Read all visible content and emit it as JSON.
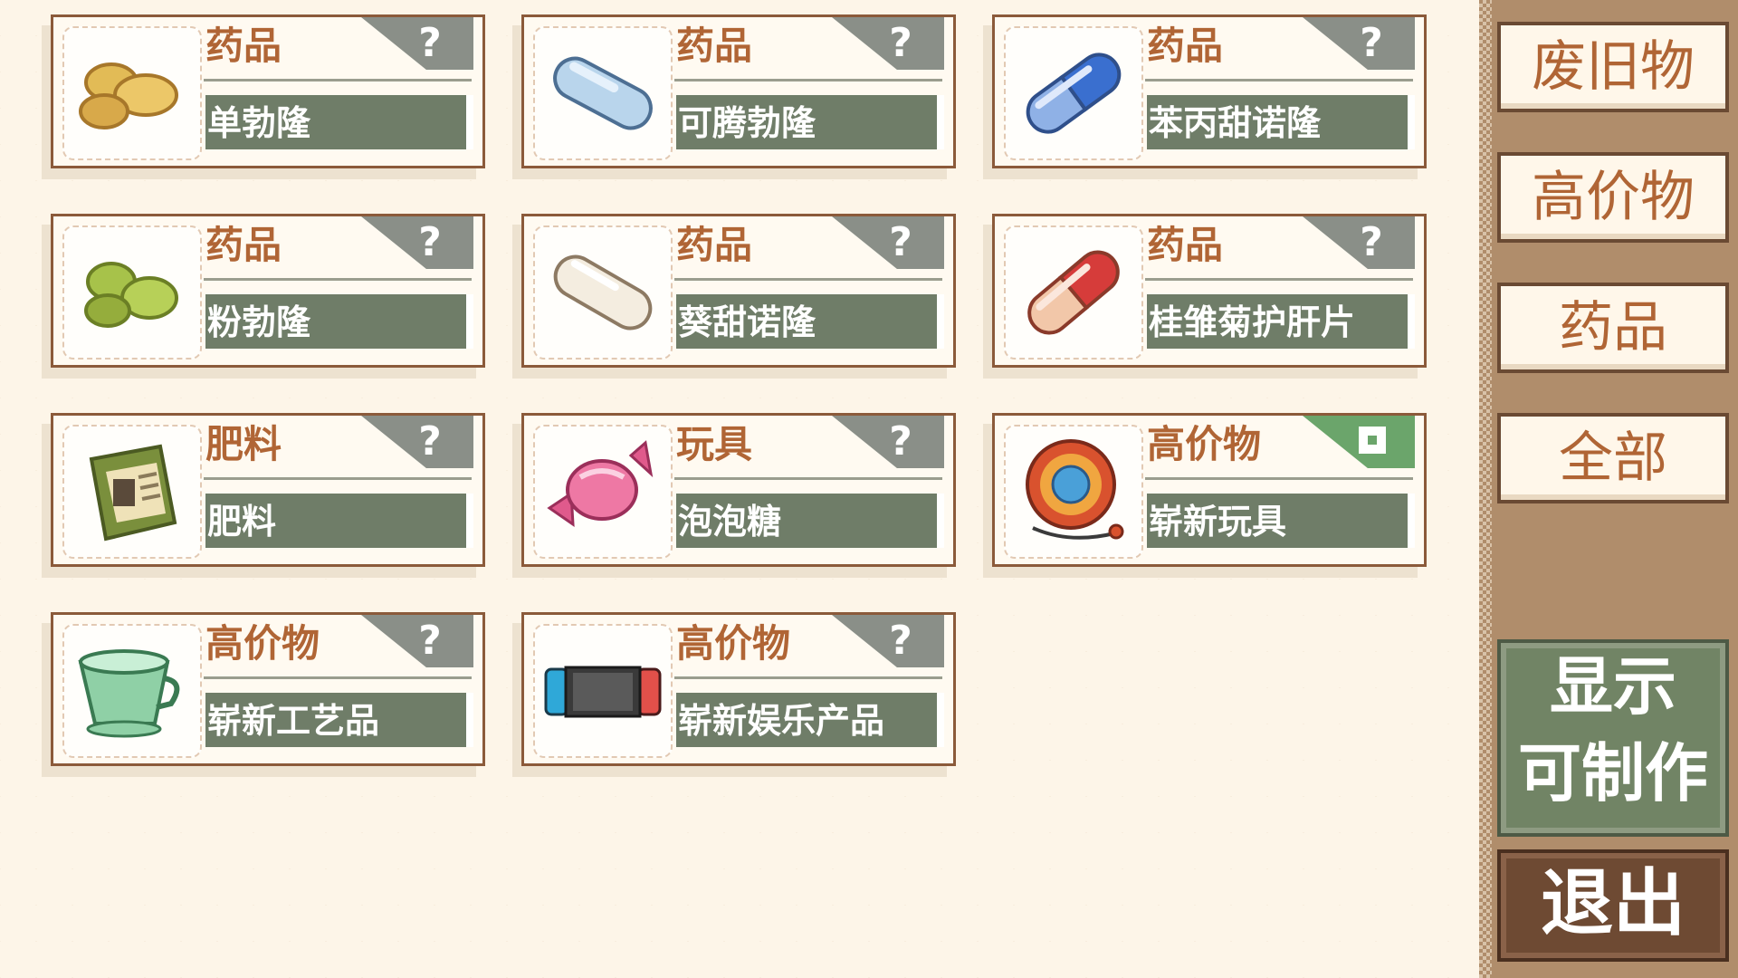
{
  "items": [
    {
      "category": "药品",
      "name": "单勃隆",
      "icon": "yellow-pills-icon",
      "badge": "?",
      "locked": true
    },
    {
      "category": "药品",
      "name": "可腾勃隆",
      "icon": "light-blue-capsule-icon",
      "badge": "?",
      "locked": true
    },
    {
      "category": "药品",
      "name": "苯丙甜诺隆",
      "icon": "blue-capsule-icon",
      "badge": "?",
      "locked": true
    },
    {
      "category": "药品",
      "name": "粉勃隆",
      "icon": "green-pills-icon",
      "badge": "?",
      "locked": true
    },
    {
      "category": "药品",
      "name": "葵甜诺隆",
      "icon": "white-capsule-icon",
      "badge": "?",
      "locked": true
    },
    {
      "category": "药品",
      "name": "桂雏菊护肝片",
      "icon": "red-capsule-icon",
      "badge": "?",
      "locked": true
    },
    {
      "category": "肥料",
      "name": "肥料",
      "icon": "fertilizer-bag-icon",
      "badge": "?",
      "locked": true
    },
    {
      "category": "玩具",
      "name": "泡泡糖",
      "icon": "candy-icon",
      "badge": "?",
      "locked": true
    },
    {
      "category": "高价物",
      "name": "崭新玩具",
      "icon": "yoyo-icon",
      "badge": "",
      "locked": false
    },
    {
      "category": "高价物",
      "name": "崭新工艺品",
      "icon": "teacup-icon",
      "badge": "?",
      "locked": true
    },
    {
      "category": "高价物",
      "name": "崭新娱乐产品",
      "icon": "game-console-icon",
      "badge": "?",
      "locked": true
    }
  ],
  "sidebar": {
    "filters": [
      "废旧物",
      "高价物",
      "药品",
      "全部"
    ],
    "craft_line1": "显示",
    "craft_line2": "可制作",
    "exit": "退出"
  },
  "colors": {
    "background": "#fdf5e8",
    "card_border": "#8b5a3a",
    "category_text": "#b06535",
    "name_bar": "#6f7d68",
    "locked_tab": "#8a8f88",
    "unlocked_tab": "#6ba56b",
    "sidebar": "#b08d6b",
    "craft_button": "#718465",
    "exit_button": "#6e4a33"
  }
}
